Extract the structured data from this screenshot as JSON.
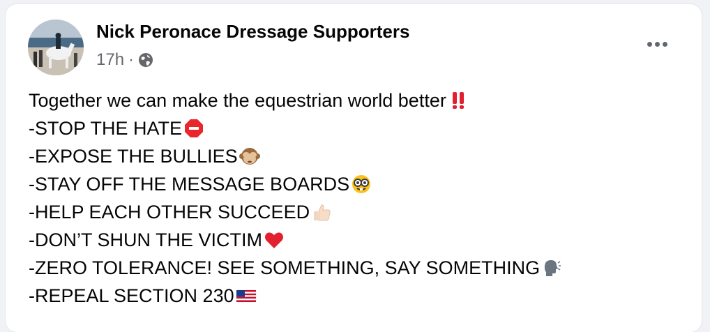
{
  "post": {
    "page_name": "Nick Peronace Dressage Supporters",
    "timestamp": "17h",
    "separator": "·",
    "audience_icon": "globe-icon",
    "more_icon": "more-horizontal-icon",
    "lines": [
      {
        "text": "Together we can make the equestrian world better",
        "emoji": "double-exclamation"
      },
      {
        "text": "-STOP THE HATE",
        "emoji": "stop-sign"
      },
      {
        "text": "-EXPOSE THE BULLIES",
        "emoji": "see-no-evil-monkey"
      },
      {
        "text": "-STAY OFF THE MESSAGE BOARDS",
        "emoji": "nerd-face"
      },
      {
        "text": "-HELP EACH OTHER SUCCEED",
        "emoji": "thumbs-up"
      },
      {
        "text": "-DON’T SHUN THE VICTIM",
        "emoji": "red-heart"
      },
      {
        "text": "-ZERO TOLERANCE! SEE SOMETHING, SAY SOMETHING ",
        "emoji": "speaking-head"
      },
      {
        "text": "-REPEAL SECTION 230",
        "emoji": "us-flag"
      }
    ]
  },
  "colors": {
    "text": "#050505",
    "secondary": "#65676b",
    "card": "#ffffff",
    "background": "#f0f2f5"
  }
}
